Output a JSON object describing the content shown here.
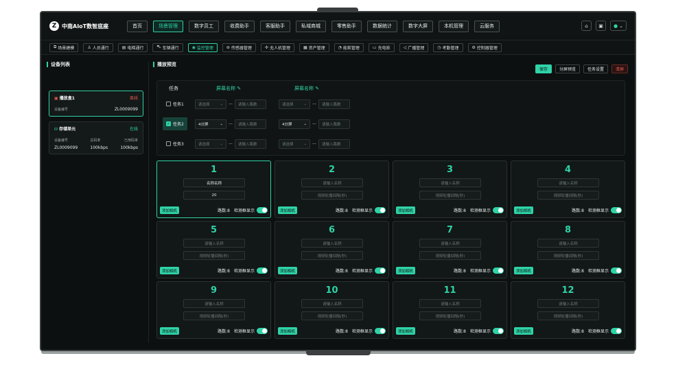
{
  "app": {
    "title": "中南AIoT数智底座",
    "logo_letter": "Z"
  },
  "nav": [
    {
      "label": "首页",
      "active": false
    },
    {
      "label": "场景管理",
      "active": true
    },
    {
      "label": "数字员工",
      "active": false
    },
    {
      "label": "收费助手",
      "active": false
    },
    {
      "label": "客服助手",
      "active": false
    },
    {
      "label": "私域商城",
      "active": false
    },
    {
      "label": "零售助手",
      "active": false
    },
    {
      "label": "数据统计",
      "active": false
    },
    {
      "label": "数字大屏",
      "active": false
    },
    {
      "label": "本机管理",
      "active": false
    },
    {
      "label": "云服务",
      "active": false
    }
  ],
  "subnav": [
    {
      "label": "场景建模",
      "icon": "cube-icon",
      "active": false
    },
    {
      "label": "人员通行",
      "icon": "person-icon",
      "active": false
    },
    {
      "label": "电梯通行",
      "icon": "elevator-icon",
      "active": false
    },
    {
      "label": "车辆通行",
      "icon": "car-icon",
      "active": false
    },
    {
      "label": "监控管理",
      "icon": "location-icon",
      "active": true
    },
    {
      "label": "传感器管理",
      "icon": "sensor-icon",
      "active": false
    },
    {
      "label": "无人机管理",
      "icon": "drone-icon",
      "active": false
    },
    {
      "label": "资产管理",
      "icon": "asset-icon",
      "active": false
    },
    {
      "label": "能耗管理",
      "icon": "energy-icon",
      "active": false
    },
    {
      "label": "充电桩",
      "icon": "charger-icon",
      "active": false
    },
    {
      "label": "广播管理",
      "icon": "speaker-icon",
      "active": false
    },
    {
      "label": "考勤管理",
      "icon": "attendance-icon",
      "active": false
    },
    {
      "label": "控制器管理",
      "icon": "controller-icon",
      "active": false
    }
  ],
  "device_list": {
    "title": "设备列表",
    "player": {
      "name": "播放盒1",
      "status": "离线",
      "id_label": "设备编号",
      "id_value": "ZL0009099"
    },
    "storage": {
      "name": "存储单元",
      "status": "在线",
      "id_label": "设备编号",
      "id_value": "ZL0009099",
      "total_label": "总码率",
      "total_value": "100kbps",
      "used_label": "已用码率",
      "used_value": "100kbps"
    }
  },
  "playback": {
    "title": "播放预览",
    "actions": {
      "save": "保存",
      "split": "分屏预览",
      "task_settings": "任务设置",
      "clear": "清屏"
    },
    "task_header": "任务",
    "screen_header": "屏幕名称",
    "tasks": [
      {
        "label": "任务1",
        "checked": false,
        "s1_select": "请选择",
        "s1_input": "请输入路数",
        "s2_select": "请选择",
        "s2_input": "请输入路数"
      },
      {
        "label": "任务2",
        "checked": true,
        "s1_select": "4分屏",
        "s1_input": "请输入路数",
        "s2_select": "4分屏",
        "s2_input": "请输入路数"
      },
      {
        "label": "任务3",
        "checked": false,
        "s1_select": "请选择",
        "s1_input": "请输入路数",
        "s2_select": "请选择",
        "s2_input": "请输入路数"
      }
    ],
    "cell_add_camera": "添加相机",
    "cell_ways": "路数:8",
    "cell_detect": "检测框显示",
    "cells": [
      {
        "num": "1",
        "name": "名称名称",
        "interval": "20",
        "filled": true
      },
      {
        "num": "2",
        "name": "请输入名称",
        "interval": "视频轮播间隔(秒)",
        "filled": false
      },
      {
        "num": "3",
        "name": "请输入名称",
        "interval": "视频轮播间隔(秒)",
        "filled": false
      },
      {
        "num": "4",
        "name": "请输入名称",
        "interval": "视频轮播间隔(秒)",
        "filled": false
      },
      {
        "num": "5",
        "name": "请输入名称",
        "interval": "视频轮播间隔(秒)",
        "filled": false
      },
      {
        "num": "6",
        "name": "请输入名称",
        "interval": "视频轮播间隔(秒)",
        "filled": false
      },
      {
        "num": "7",
        "name": "请输入名称",
        "interval": "视频轮播间隔(秒)",
        "filled": false
      },
      {
        "num": "8",
        "name": "请输入名称",
        "interval": "视频轮播间隔(秒)",
        "filled": false
      },
      {
        "num": "9",
        "name": "请输入名称",
        "interval": "视频轮播间隔(秒)",
        "filled": false
      },
      {
        "num": "10",
        "name": "请输入名称",
        "interval": "视频轮播间隔(秒)",
        "filled": false
      },
      {
        "num": "11",
        "name": "请输入名称",
        "interval": "视频轮播间隔(秒)",
        "filled": false
      },
      {
        "num": "12",
        "name": "请输入名称",
        "interval": "视频轮播间隔(秒)",
        "filled": false
      }
    ]
  },
  "colors": {
    "accent": "#2fd3a7",
    "danger": "#e05a4f",
    "background": "#0d1010"
  }
}
